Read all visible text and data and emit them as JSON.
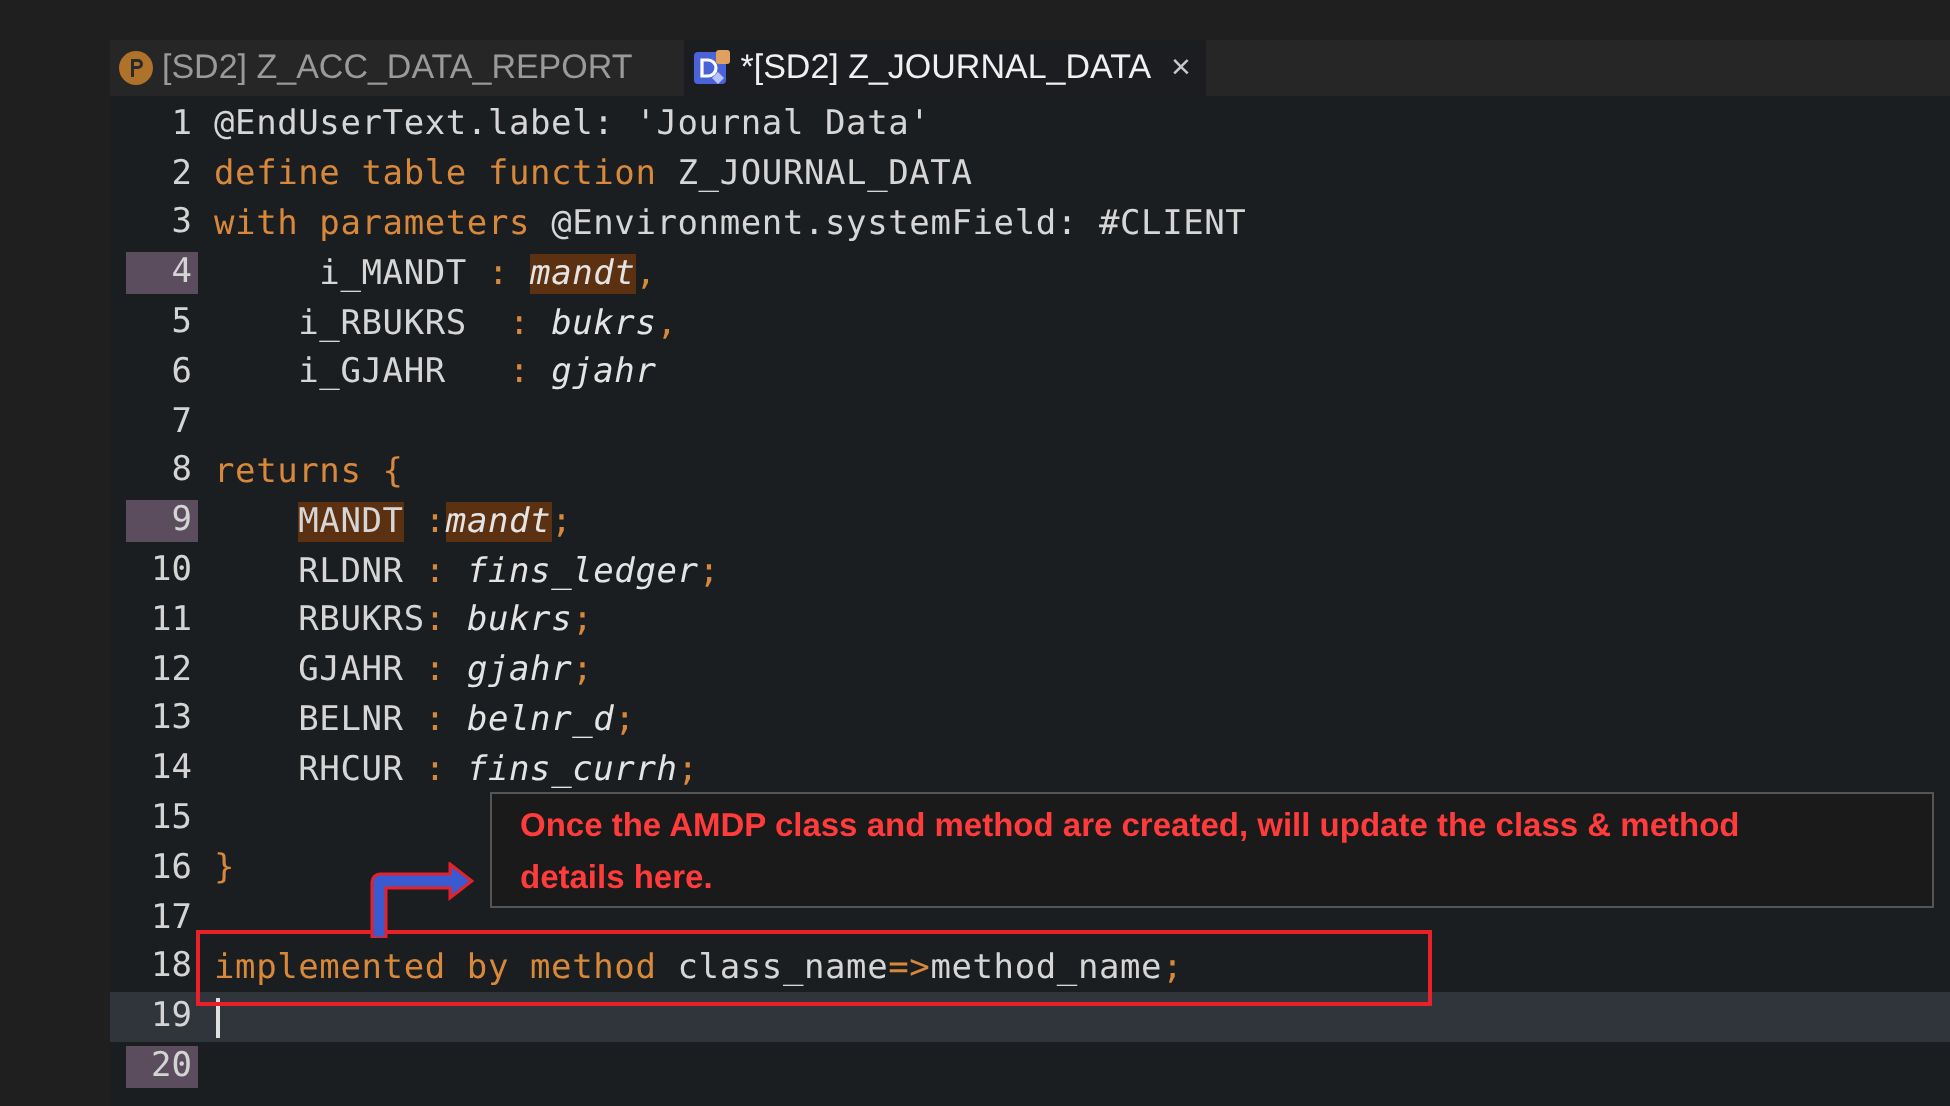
{
  "tabs": [
    {
      "label": "[SD2] Z_ACC_DATA_REPORT",
      "kind": "program",
      "selected": false,
      "closable": false
    },
    {
      "label": "*[SD2] Z_JOURNAL_DATA",
      "kind": "cds",
      "selected": true,
      "closable": true,
      "close": "×"
    }
  ],
  "editor": {
    "lines": [
      {
        "number": "1",
        "marked": false,
        "current": false,
        "tokens": [
          {
            "text": "@EndUserText.label: 'Journal Data'",
            "kind": "plain"
          }
        ]
      },
      {
        "number": "2",
        "marked": false,
        "current": false,
        "tokens": [
          {
            "text": "define table function",
            "kind": "keyword"
          },
          {
            "text": " Z_JOURNAL_DATA",
            "kind": "plain"
          }
        ]
      },
      {
        "number": "3",
        "marked": false,
        "current": false,
        "tokens": [
          {
            "text": "with parameters",
            "kind": "keyword"
          },
          {
            "text": " @Environment.systemField: #CLIENT",
            "kind": "plain"
          }
        ]
      },
      {
        "number": "4",
        "marked": true,
        "current": false,
        "tokens": [
          {
            "text": "     i_MANDT ",
            "kind": "plain",
            "highlight": false
          },
          {
            "text": ": ",
            "kind": "punct",
            "highlight": false
          },
          {
            "text": "mandt",
            "kind": "type",
            "highlight": true
          },
          {
            "text": ",",
            "kind": "punct",
            "highlight": false
          }
        ]
      },
      {
        "number": "5",
        "marked": false,
        "current": false,
        "tokens": [
          {
            "text": "    i_RBUKRS  ",
            "kind": "plain"
          },
          {
            "text": ": ",
            "kind": "punct"
          },
          {
            "text": "bukrs",
            "kind": "type"
          },
          {
            "text": ",",
            "kind": "punct"
          }
        ]
      },
      {
        "number": "6",
        "marked": false,
        "current": false,
        "tokens": [
          {
            "text": "    i_GJAHR   ",
            "kind": "plain"
          },
          {
            "text": ": ",
            "kind": "punct"
          },
          {
            "text": "gjahr",
            "kind": "type"
          }
        ]
      },
      {
        "number": "7",
        "marked": false,
        "current": false
      },
      {
        "number": "8",
        "marked": false,
        "current": false,
        "tokens": [
          {
            "text": "returns {",
            "kind": "keyword"
          }
        ]
      },
      {
        "number": "9",
        "marked": true,
        "current": false,
        "tokens": [
          {
            "text": "    MANDT",
            "kind": "plain",
            "highlight": true
          },
          {
            "text": " :",
            "kind": "punct",
            "highlight": false
          },
          {
            "text": "mandt",
            "kind": "type",
            "highlight": true
          },
          {
            "text": ";",
            "kind": "punct",
            "highlight": false
          }
        ]
      },
      {
        "number": "10",
        "marked": false,
        "current": false,
        "tokens": [
          {
            "text": "    RLDNR ",
            "kind": "plain"
          },
          {
            "text": ": ",
            "kind": "punct"
          },
          {
            "text": "fins_ledger",
            "kind": "type"
          },
          {
            "text": ";",
            "kind": "punct"
          }
        ]
      },
      {
        "number": "11",
        "marked": false,
        "current": false,
        "tokens": [
          {
            "text": "    RBUKRS",
            "kind": "plain"
          },
          {
            "text": ": ",
            "kind": "punct"
          },
          {
            "text": "bukrs",
            "kind": "type"
          },
          {
            "text": ";",
            "kind": "punct"
          }
        ]
      },
      {
        "number": "12",
        "marked": false,
        "current": false,
        "tokens": [
          {
            "text": "    GJAHR ",
            "kind": "plain"
          },
          {
            "text": ": ",
            "kind": "punct"
          },
          {
            "text": "gjahr",
            "kind": "type"
          },
          {
            "text": ";",
            "kind": "punct"
          }
        ]
      },
      {
        "number": "13",
        "marked": false,
        "current": false,
        "tokens": [
          {
            "text": "    BELNR ",
            "kind": "plain"
          },
          {
            "text": ": ",
            "kind": "punct"
          },
          {
            "text": "belnr_d",
            "kind": "type"
          },
          {
            "text": ";",
            "kind": "punct"
          }
        ]
      },
      {
        "number": "14",
        "marked": false,
        "current": false,
        "tokens": [
          {
            "text": "    RHCUR ",
            "kind": "plain"
          },
          {
            "text": ": ",
            "kind": "punct"
          },
          {
            "text": "fins_currh",
            "kind": "type"
          },
          {
            "text": ";",
            "kind": "punct"
          }
        ]
      },
      {
        "number": "15",
        "marked": false,
        "current": false
      },
      {
        "number": "16",
        "marked": false,
        "current": false,
        "tokens": [
          {
            "text": "}",
            "kind": "keyword"
          }
        ]
      },
      {
        "number": "17",
        "marked": false,
        "current": false
      },
      {
        "number": "18",
        "marked": false,
        "current": false,
        "tokens": [
          {
            "text": "implemented by method",
            "kind": "keyword"
          },
          {
            "text": " class_name",
            "kind": "plain"
          },
          {
            "text": "=>",
            "kind": "punct"
          },
          {
            "text": "method_name",
            "kind": "plain"
          },
          {
            "text": ";",
            "kind": "punct"
          }
        ]
      },
      {
        "number": "19",
        "marked": false,
        "current": true
      },
      {
        "number": "20",
        "marked": true,
        "current": false
      }
    ]
  },
  "callout": {
    "text": "Once the AMDP class and method are created, will update the class & method details here."
  }
}
